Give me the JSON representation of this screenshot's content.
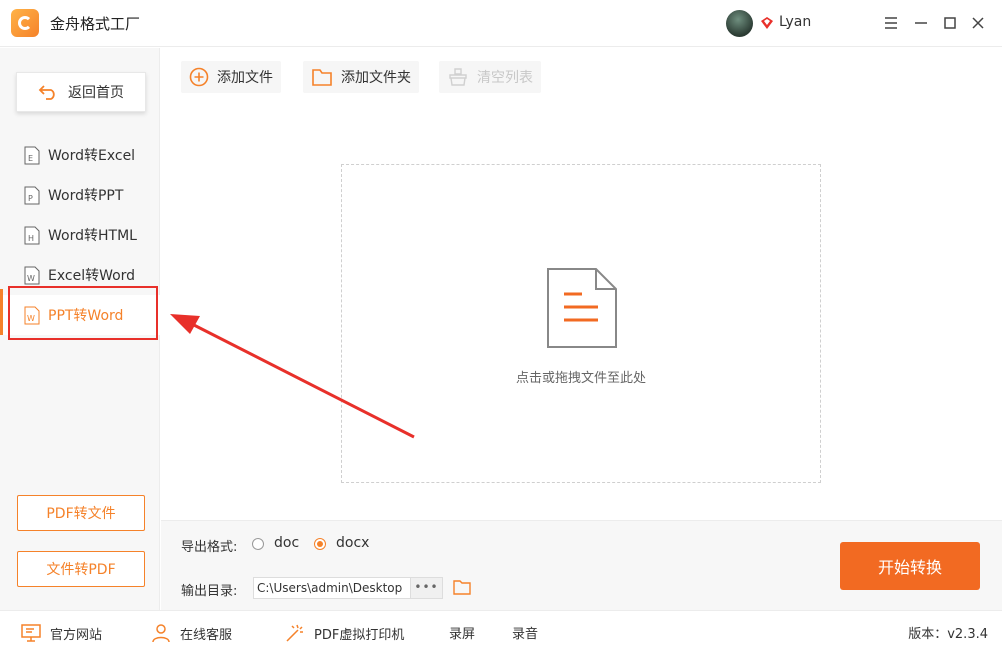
{
  "app": {
    "title": "金舟格式工厂"
  },
  "user": {
    "name": "Lyan"
  },
  "sidebar": {
    "home_label": "返回首页",
    "items": [
      {
        "label": "Word转Excel",
        "icon_letter": "E"
      },
      {
        "label": "Word转PPT",
        "icon_letter": "P"
      },
      {
        "label": "Word转HTML",
        "icon_letter": "H"
      },
      {
        "label": "Excel转Word",
        "icon_letter": "W"
      },
      {
        "label": "PPT转Word",
        "icon_letter": "W",
        "active": true
      }
    ],
    "pdf_to_file": "PDF转文件",
    "file_to_pdf": "文件转PDF"
  },
  "toolbar": {
    "add_file": "添加文件",
    "add_folder": "添加文件夹",
    "clear_list": "清空列表"
  },
  "dropzone": {
    "hint": "点击或拖拽文件至此处"
  },
  "output": {
    "format_label": "导出格式:",
    "formats": [
      {
        "label": "doc",
        "selected": false
      },
      {
        "label": "docx",
        "selected": true
      }
    ],
    "dir_label": "输出目录:",
    "dir_value": "C:\\Users\\admin\\Desktop",
    "browse_label": "•••",
    "start_label": "开始转换"
  },
  "footer": {
    "website": "官方网站",
    "support": "在线客服",
    "printer": "PDF虚拟打印机",
    "screen_record": "录屏",
    "audio_record": "录音",
    "version": "版本：v2.3.4"
  },
  "colors": {
    "accent": "#f5822a",
    "start_button": "#f26a22",
    "annotation": "#e8302a"
  }
}
